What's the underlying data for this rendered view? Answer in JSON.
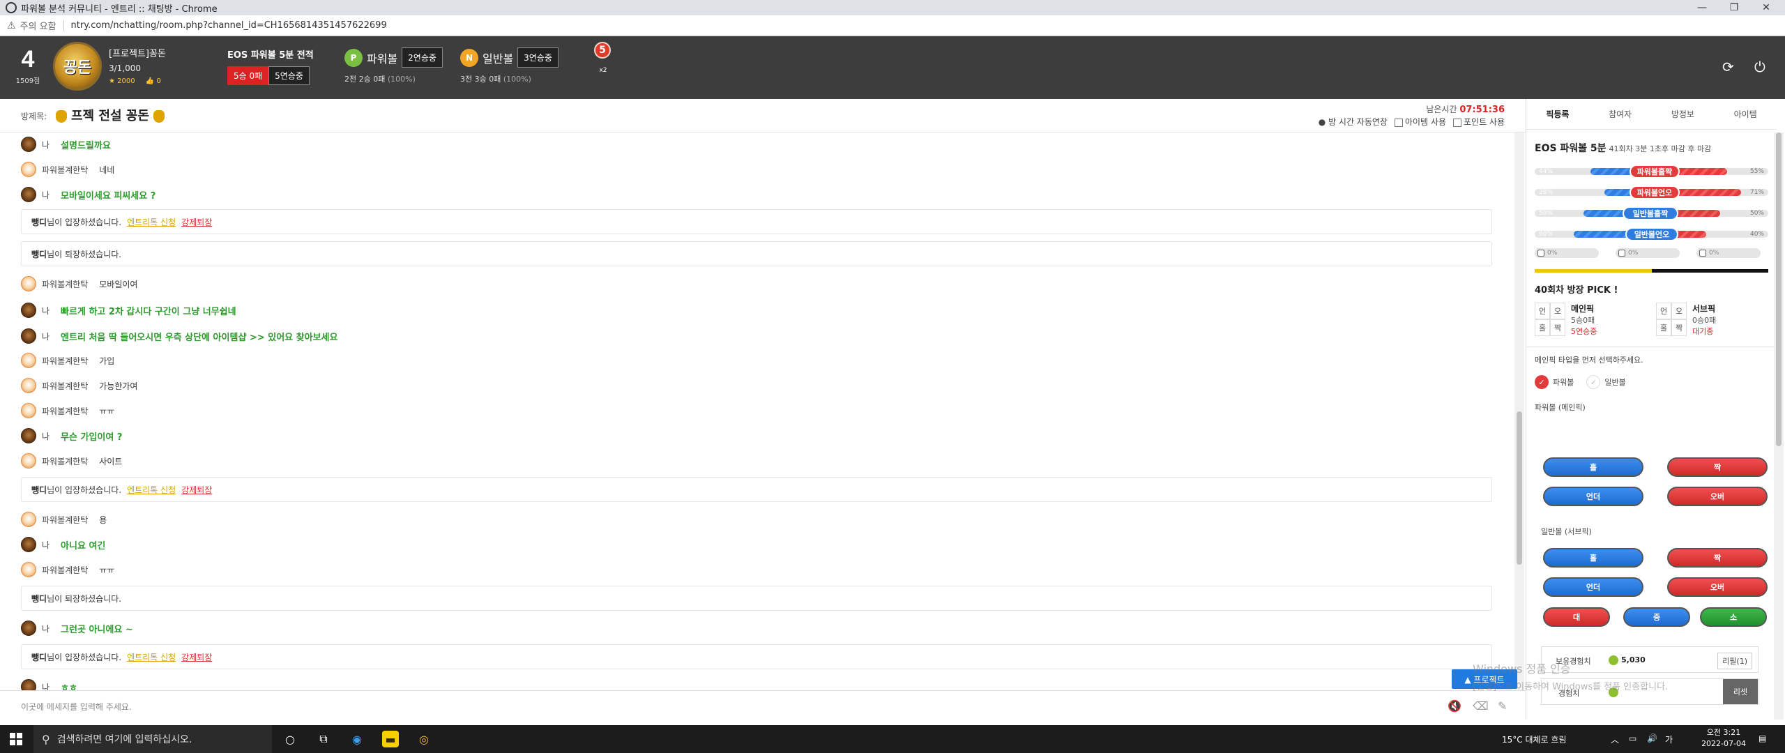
{
  "window": {
    "title": "파워볼 분석 커뮤니티 - 엔트리 :: 채팅방 - Chrome",
    "address_warning": "주의 요함",
    "url": "ntry.com/nchatting/room.php?channel_id=CH1656814351457622699"
  },
  "profile": {
    "level": "4",
    "points": "1509점",
    "avatar_text": "꽁돈",
    "name": "[프로젝트]꽁돈",
    "count": "3/1,000",
    "stars": "2000",
    "likes": "0"
  },
  "record": {
    "title": "EOS 파워볼 5분 전적",
    "badge1": "5승 0패",
    "badge2": "5연승중"
  },
  "powerball": {
    "icon": "P",
    "label": "파워볼",
    "streak": "2연승중",
    "summary": "2전 2승 0패",
    "pct": "(100%)"
  },
  "normalball": {
    "icon": "N",
    "label": "일반볼",
    "streak": "3연승중",
    "summary": "3전 3승 0패",
    "pct": "(100%)"
  },
  "medal": {
    "value": "5",
    "mult": "x2"
  },
  "room": {
    "label": "방제목:",
    "title": "프젝 전설 꽁돈",
    "timer_label": "남은시간",
    "timer": "07:51:36",
    "opt_extend": "방 시간 자동연장",
    "opt_item": "아이템 사용",
    "opt_point": "포인트 사용"
  },
  "chat": {
    "me_name": "나",
    "other_name": "파워볼계한탁",
    "sys_enter_tail": "님이 입장하셨습니다.",
    "sys_leave_tail": "님이 퇴장하셨습니다.",
    "sys_user": "뺑디",
    "link_apply": "엔트리톡 신청",
    "link_kick": "강제퇴장",
    "messages": [
      "설명드릴까요",
      "네네",
      "모바일이세요 피씨세요 ?",
      "모바일이여",
      "빠르게 하고 2차 갑시다 구간이 그냥 너무쉽네",
      "엔트리 처음 딱 들어오시면 우측 상단에 아이템샵 >> 있어요 찾아보세요",
      "가입",
      "가능한가여",
      "ㅠㅠ",
      "무슨 가입이여 ?",
      "사이트",
      "용",
      "아니요 여긴",
      "ㅠㅠ",
      "그런곳 아니에요 ~",
      "ㅎㅎ"
    ],
    "input_placeholder": "이곳에 메세지를 입력해 주세요.",
    "protect_label": "▲ 프로젝트"
  },
  "side": {
    "tabs": [
      "픽등록",
      "참여자",
      "방정보",
      "아이템"
    ],
    "eos_title": "EOS 파워볼 5분",
    "eos_sub": "41회차 3분 1초후 마감 후 마감",
    "bars": [
      {
        "left": "44%",
        "right": "55%",
        "label": "파워볼홀짝",
        "blue": 0.44
      },
      {
        "left": "28%",
        "right": "71%",
        "label": "파워볼언오",
        "blue": 0.28
      },
      {
        "left": "50%",
        "right": "50%",
        "label": "일반볼홀짝",
        "blue": 0.5
      },
      {
        "left": "60%",
        "right": "40%",
        "label": "일반볼언오",
        "blue": 0.6
      }
    ],
    "mini": [
      "0%",
      "0%",
      "0%"
    ],
    "pick_title": "40회차 방장 PICK !",
    "pick_cells1": [
      "언",
      "오",
      "홀",
      "짝"
    ],
    "pick_main_name": "메인픽",
    "pick_main_rec": "5승0패",
    "pick_main_streak": "5연승중",
    "pick_cells2": [
      "언",
      "오",
      "홀",
      "짝"
    ],
    "pick_sub_name": "서브픽",
    "pick_sub_rec": "0승0패",
    "pick_sub_status": "대기중",
    "hint": "메인픽 타입을 먼저 선택하주세요.",
    "radio_powerball": "파워볼",
    "radio_normal": "일반볼",
    "sec_power": "파워볼 (메인픽)",
    "sec_normal": "일반볼 (서브픽)",
    "btn_odd": "홀",
    "btn_even": "짝",
    "btn_under": "언더",
    "btn_over": "오버",
    "btn_big": "대",
    "btn_mid": "중",
    "btn_small": "소",
    "exp_label": "보유경험치",
    "exp_value": "5,030",
    "exp_refill": "리필(1)",
    "exp2_label": "경험치",
    "reset": "리셋"
  },
  "watermark": {
    "line1": "Windows 정품 인증",
    "line2": "[설정]으로 이동하여 Windows를 정품 인증합니다."
  },
  "taskbar": {
    "search_placeholder": "검색하려면 여기에 입력하십시오.",
    "weather": "15°C 대체로 흐림",
    "time": "오전 3:21",
    "date": "2022-07-04"
  }
}
